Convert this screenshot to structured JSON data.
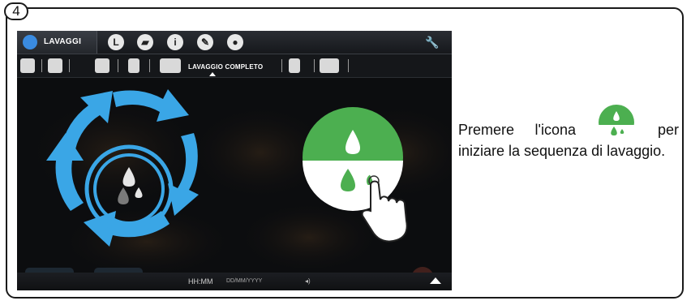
{
  "step": {
    "number": "4"
  },
  "topbar": {
    "active_tab": {
      "label": "LAVAGGI",
      "icon": "water-drop-icon"
    },
    "tabs": [
      {
        "icon": "clock-icon"
      },
      {
        "icon": "flag-icon"
      },
      {
        "icon": "info-icon"
      },
      {
        "icon": "pencil-icon"
      },
      {
        "icon": "user-icon"
      }
    ],
    "settings_icon": "wrench-icon"
  },
  "subbar": {
    "items": [
      {
        "icon": "brew-group-clean-icon"
      },
      {
        "icon": "cup-icon"
      },
      {
        "icon": "milk-pitcher-icon"
      },
      {
        "icon": "glass-icon"
      },
      {
        "icon": "full-wash-icon",
        "label": "LAVAGGIO COMPLETO",
        "selected": true
      },
      {
        "icon": "cup-rinse-icon"
      },
      {
        "icon": "descale-icon"
      }
    ]
  },
  "bottombar": {
    "time": "HH:MM",
    "date": "DD/MM/YYYY",
    "icons": [
      "speaker-icon",
      "up-arrow-icon"
    ]
  },
  "colors": {
    "accent_blue": "#38a8e8",
    "accent_green": "#4caf50",
    "screen_bg": "#0c0d0f"
  },
  "instruction": {
    "part1": "Premere l'icona",
    "part2": "per iniziare la sequenza di lavaggio.",
    "icon": "wash-start-icon"
  }
}
